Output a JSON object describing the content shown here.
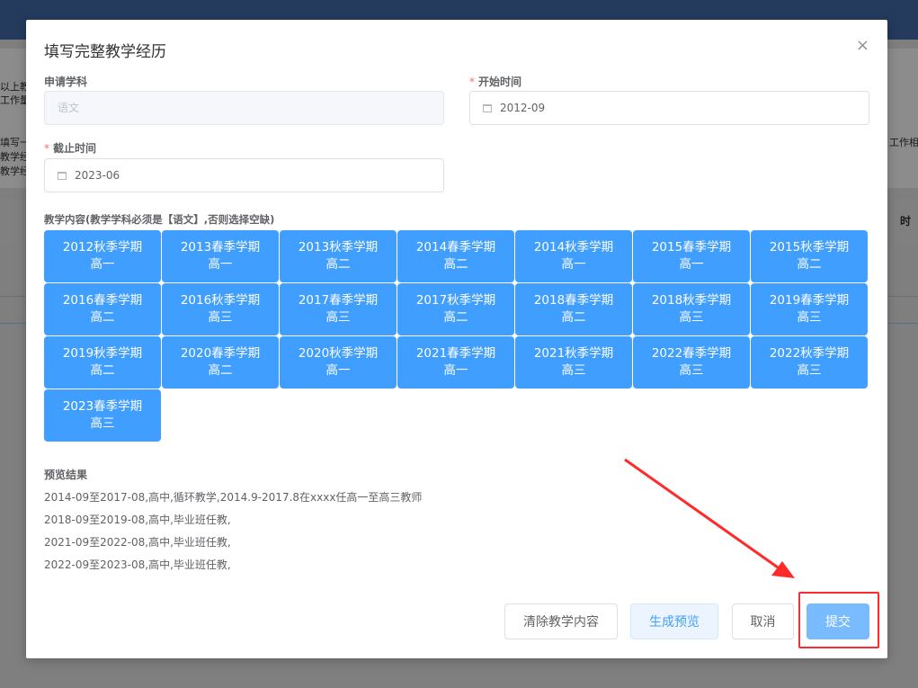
{
  "background": {
    "snippets": [
      "以上教",
      "工作量",
      "填写一",
      "教学经",
      "教学经",
      "工作相应",
      "时"
    ]
  },
  "dialog": {
    "title": "填写完整教学经历",
    "close_glyph": "×",
    "fields": {
      "subject": {
        "label": "申请学科",
        "value": "语文"
      },
      "start_time": {
        "label": "开始时间",
        "value": "2012-09"
      },
      "end_time": {
        "label": "截止时间",
        "value": "2023-06"
      }
    },
    "content_label": "教学内容(教学学科必须是【语文】,否则选择空缺)",
    "semesters": [
      {
        "term": "2012秋季学期",
        "grade": "高一"
      },
      {
        "term": "2013春季学期",
        "grade": "高一"
      },
      {
        "term": "2013秋季学期",
        "grade": "高二"
      },
      {
        "term": "2014春季学期",
        "grade": "高二"
      },
      {
        "term": "2014秋季学期",
        "grade": "高一"
      },
      {
        "term": "2015春季学期",
        "grade": "高一"
      },
      {
        "term": "2015秋季学期",
        "grade": "高二"
      },
      {
        "term": "2016春季学期",
        "grade": "高二"
      },
      {
        "term": "2016秋季学期",
        "grade": "高三"
      },
      {
        "term": "2017春季学期",
        "grade": "高三"
      },
      {
        "term": "2017秋季学期",
        "grade": "高二"
      },
      {
        "term": "2018春季学期",
        "grade": "高二"
      },
      {
        "term": "2018秋季学期",
        "grade": "高三"
      },
      {
        "term": "2019春季学期",
        "grade": "高三"
      },
      {
        "term": "2019秋季学期",
        "grade": "高二"
      },
      {
        "term": "2020春季学期",
        "grade": "高二"
      },
      {
        "term": "2020秋季学期",
        "grade": "高一"
      },
      {
        "term": "2021春季学期",
        "grade": "高一"
      },
      {
        "term": "2021秋季学期",
        "grade": "高三"
      },
      {
        "term": "2022春季学期",
        "grade": "高三"
      },
      {
        "term": "2022秋季学期",
        "grade": "高三"
      },
      {
        "term": "2023春季学期",
        "grade": "高三"
      }
    ],
    "preview": {
      "title": "预览结果",
      "lines": [
        "2014-09至2017-08,高中,循环教学,2014.9-2017.8在xxxx任高一至高三教师",
        "2018-09至2019-08,高中,毕业班任教,",
        "2021-09至2022-08,高中,毕业班任教,",
        "2022-09至2023-08,高中,毕业班任教,"
      ]
    },
    "buttons": {
      "clear": "清除教学内容",
      "generate": "生成预览",
      "cancel": "取消",
      "submit": "提交"
    }
  },
  "colors": {
    "primary": "#409eff",
    "annotation": "#ff2b2b"
  }
}
